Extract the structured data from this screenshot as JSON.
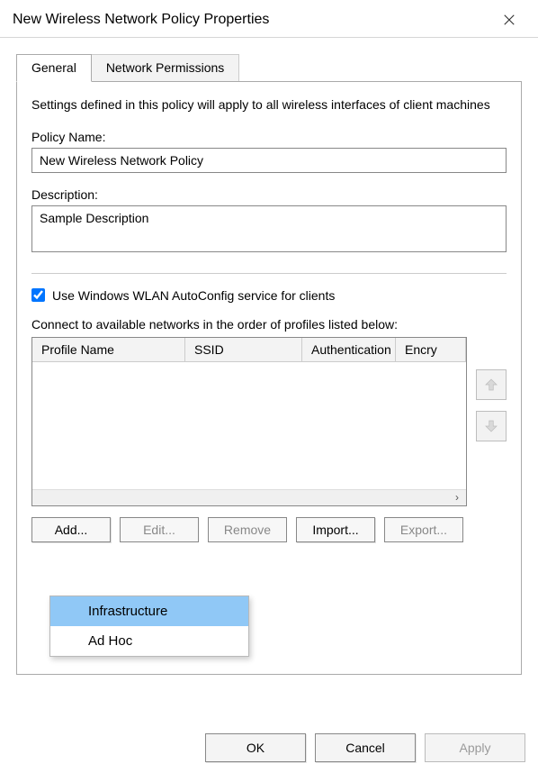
{
  "window": {
    "title": "New Wireless Network Policy Properties"
  },
  "tabs": {
    "general": "General",
    "network_permissions": "Network Permissions"
  },
  "general": {
    "description_text": "Settings defined in this policy will apply to all wireless interfaces of client machines",
    "policy_name_label": "Policy Name:",
    "policy_name_value": "New Wireless Network Policy",
    "description_label": "Description:",
    "description_value": "Sample Description",
    "autoconfig_checkbox_label": "Use Windows WLAN AutoConfig service for clients",
    "autoconfig_checked": true,
    "connect_label": "Connect to available networks in the order of profiles listed below:",
    "columns": {
      "profile": "Profile Name",
      "ssid": "SSID",
      "auth": "Authentication",
      "enc": "Encry"
    },
    "buttons": {
      "add": "Add...",
      "edit": "Edit...",
      "remove": "Remove",
      "import": "Import...",
      "export": "Export..."
    },
    "add_menu": {
      "infrastructure": "Infrastructure",
      "adhoc": "Ad Hoc"
    }
  },
  "dialog_buttons": {
    "ok": "OK",
    "cancel": "Cancel",
    "apply": "Apply"
  }
}
